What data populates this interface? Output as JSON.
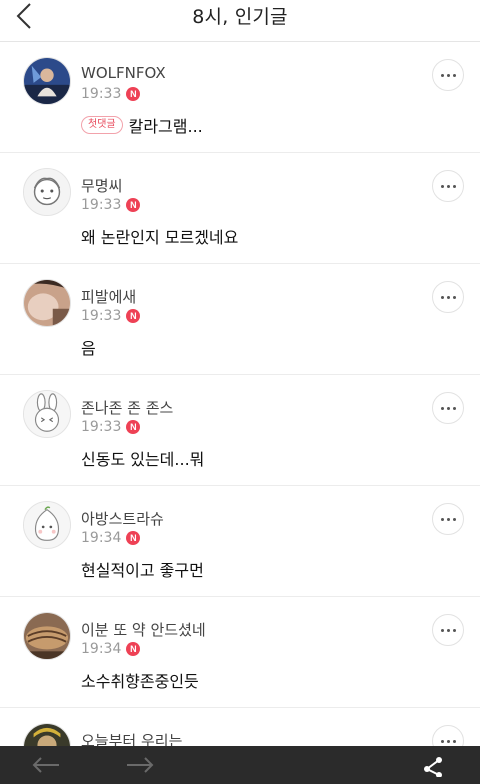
{
  "header": {
    "title": "8시, 인기글"
  },
  "colors": {
    "new_badge": "#ee4155",
    "toolbar": "#2b2b2b"
  },
  "comments": [
    {
      "nickname": "WOLFNFOX",
      "time": "19:33",
      "new_badge": "N",
      "first_badge": "첫댓글",
      "text": "칼라그램..."
    },
    {
      "nickname": "무명씨",
      "time": "19:33",
      "new_badge": "N",
      "text": "왜 논란인지 모르겠네요"
    },
    {
      "nickname": "피발에새",
      "time": "19:33",
      "new_badge": "N",
      "text": "음"
    },
    {
      "nickname": "존나존 존 존스",
      "time": "19:33",
      "new_badge": "N",
      "text": "신동도 있는데...뭐"
    },
    {
      "nickname": "아방스트라슈",
      "time": "19:34",
      "new_badge": "N",
      "text": "현실적이고 좋구먼"
    },
    {
      "nickname": "이분 또 약 안드셨네",
      "time": "19:34",
      "new_badge": "N",
      "text": "소수취향존중인듯"
    },
    {
      "nickname": "오늘부터 우리는"
    }
  ],
  "toolbar": {
    "icons": [
      "arrow-left-icon",
      "arrow-right-icon",
      "share-icon"
    ]
  }
}
